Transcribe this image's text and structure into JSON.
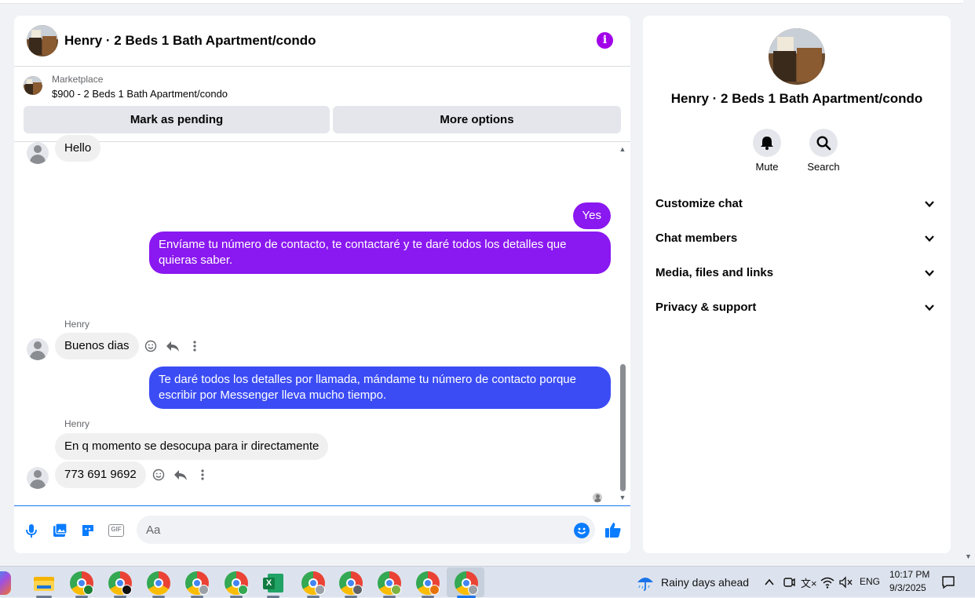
{
  "chat": {
    "title": "Henry · 2 Beds 1 Bath Apartment/condo",
    "marketplace_label": "Marketplace",
    "listing_title": "$900 - 2 Beds 1 Bath Apartment/condo",
    "mark_pending_label": "Mark as pending",
    "more_options_label": "More options"
  },
  "messages": [
    {
      "from": "them",
      "text": "Hello"
    },
    {
      "from": "me",
      "text": "Yes"
    },
    {
      "from": "me",
      "text": "Envíame tu número de contacto, te contactaré y te daré todos los detalles que quieras saber."
    },
    {
      "from": "them",
      "sender": "Henry",
      "text": "Buenos dias"
    },
    {
      "from": "me",
      "text": "Te daré todos los detalles por llamada, mándame tu número de contacto porque escribir por Messenger lleva mucho tiempo."
    },
    {
      "from": "them",
      "sender": "Henry",
      "text": "En q momento se desocupa para ir directamente"
    },
    {
      "from": "them",
      "text": "773 691 9692"
    }
  ],
  "composer": {
    "placeholder": "Aa",
    "tools": [
      "microphone-icon",
      "photo-icon",
      "sticker-icon",
      "gif-icon"
    ],
    "gif_label": "GIF"
  },
  "panel": {
    "name": "Henry · 2 Beds 1 Bath Apartment/condo",
    "mute_label": "Mute",
    "search_label": "Search",
    "sections": [
      "Customize chat",
      "Chat members",
      "Media, files and links",
      "Privacy & support"
    ]
  },
  "taskbar": {
    "weather": "Rainy days ahead",
    "language": "ENG",
    "time": "10:17 PM",
    "date": "9/3/2025"
  },
  "colors": {
    "accent": "#a100e8",
    "bubble_purple": "#8a18f0",
    "bubble_blue": "#3b4cf5",
    "bubble_gray": "#f0f0f0",
    "link_blue": "#0a7cff"
  }
}
